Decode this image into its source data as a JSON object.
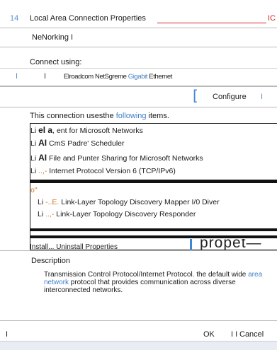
{
  "window": {
    "number": "14",
    "title": "Local Area Connection Properties",
    "close_label": "IC"
  },
  "tabs": [
    {
      "label": "NeNorking I"
    }
  ],
  "connect": {
    "label": "Connect using:",
    "marker_left": "I",
    "marker_mid": "I",
    "adapter_name_part1": "Elroadcom NetSgreme ",
    "adapter_name_highlight": "Gigabit",
    "adapter_name_part2": " Ethernet"
  },
  "configure": {
    "bracket": "[",
    "label": "Configure",
    "trailing_bar": "I"
  },
  "items": {
    "intro_part1": "This connection usesthe ",
    "intro_highlight": "following",
    "intro_part2": " items.",
    "list": [
      {
        "prefix": "Li ",
        "mid": "el a",
        "rest": ", ent for Microsoft Networks"
      },
      {
        "prefix": "Li ",
        "mid": "AI",
        "rest": " CmS Padre' Scheduler"
      },
      {
        "prefix": "Li ",
        "mid": "AI",
        "rest": " File and Punter Sharing for Microsoft Networks"
      },
      {
        "prefix": "Li ",
        "mid": "..,-",
        "rest": " Internet Protocol Version 6 (TCP/IPv6)"
      },
      {
        "prefix": "o\"",
        "mid": "",
        "rest": ""
      },
      {
        "prefix": "Li ",
        "mid": "-..E.",
        "rest": " Link-Layer Topology Discovery Mapper I/0 Diver"
      },
      {
        "prefix": "Li ",
        "mid": "..,-",
        "rest": " Link-Layer Topology Discovery Responder"
      }
    ],
    "install_text": "Install... Uninstall Properties",
    "properties_label": "propet—"
  },
  "description": {
    "title": "Description",
    "text_part1": "Transmission Control Protocol/Internet Protocol. the default wide ",
    "text_highlight": "area network",
    "text_part2": " protocol that provides communication across diverse interconnected networks."
  },
  "footer": {
    "left_bar": "I",
    "ok_label": "OK",
    "separator": "I I",
    "cancel_label": "Cancel"
  },
  "colors": {
    "accent_blue": "#3f86d6",
    "title_rule_red": "#d22424",
    "strip": "#e8ecf3"
  }
}
